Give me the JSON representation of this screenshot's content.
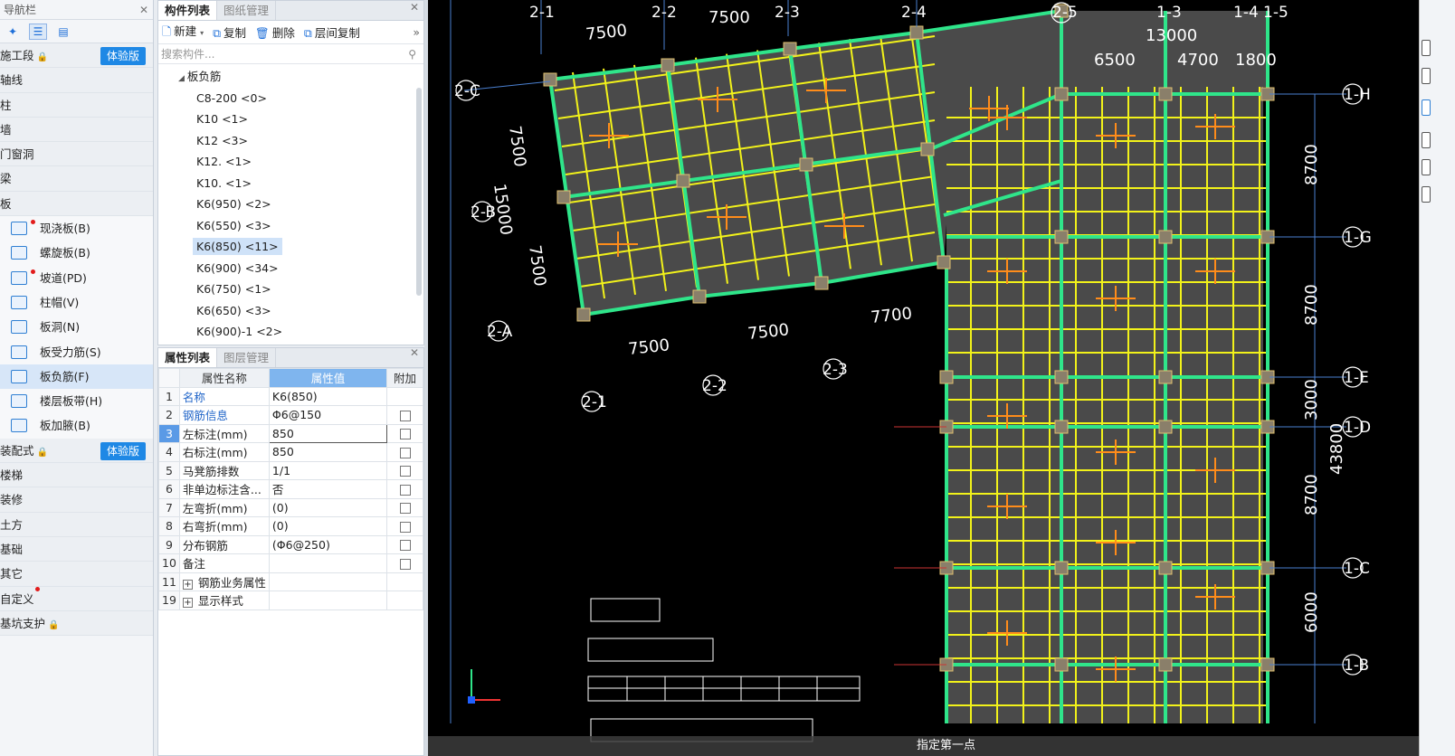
{
  "nav": {
    "title": "导航栏",
    "categories": [
      {
        "label": "施工段",
        "lock": true,
        "trial": "体验版"
      },
      {
        "label": "轴线"
      },
      {
        "label": "柱"
      },
      {
        "label": "墙"
      },
      {
        "label": "门窗洞"
      },
      {
        "label": "梁"
      },
      {
        "label": "板"
      }
    ],
    "slab_items": [
      {
        "label": "现浇板(B)",
        "dot": true
      },
      {
        "label": "螺旋板(B)"
      },
      {
        "label": "坡道(PD)",
        "dot": true
      },
      {
        "label": "柱帽(V)"
      },
      {
        "label": "板洞(N)"
      },
      {
        "label": "板受力筋(S)"
      },
      {
        "label": "板负筋(F)",
        "selected": true
      },
      {
        "label": "楼层板带(H)"
      },
      {
        "label": "板加腋(B)"
      }
    ],
    "categories_after": [
      {
        "label": "装配式",
        "lock": true,
        "trial": "体验版"
      },
      {
        "label": "楼梯"
      },
      {
        "label": "装修"
      },
      {
        "label": "土方"
      },
      {
        "label": "基础"
      },
      {
        "label": "其它"
      },
      {
        "label": "自定义",
        "dot": true
      },
      {
        "label": "基坑支护",
        "lock": true
      }
    ]
  },
  "component_panel": {
    "tabs": [
      "构件列表",
      "图纸管理"
    ],
    "toolbar": {
      "new": "新建",
      "copy": "复制",
      "delete": "删除",
      "floor_copy": "层间复制"
    },
    "search_placeholder": "搜索构件...",
    "tree_root": "板负筋",
    "items": [
      "C8-200 <0>",
      "K10 <1>",
      "K12 <3>",
      "K12. <1>",
      "K10. <1>",
      "K6(950) <2>",
      "K6(550) <3>",
      "K6(850) <11>",
      "K6(900) <34>",
      "K6(750) <1>",
      "K6(650) <3>",
      "K6(900)-1 <2>"
    ],
    "selected_index": 7
  },
  "property_panel": {
    "tabs": [
      "属性列表",
      "图层管理"
    ],
    "headers": {
      "name": "属性名称",
      "value": "属性值",
      "extra": "附加"
    },
    "rows": [
      {
        "no": "1",
        "name": "名称",
        "value": "K6(850)",
        "blue": true,
        "check": false
      },
      {
        "no": "2",
        "name": "钢筋信息",
        "value": "Φ6@150",
        "blue": true,
        "check": true
      },
      {
        "no": "3",
        "name": "左标注(mm)",
        "value": "850",
        "check": true,
        "current": true
      },
      {
        "no": "4",
        "name": "右标注(mm)",
        "value": "850",
        "check": true
      },
      {
        "no": "5",
        "name": "马凳筋排数",
        "value": "1/1",
        "check": true
      },
      {
        "no": "6",
        "name": "非单边标注含...",
        "value": "否",
        "check": true
      },
      {
        "no": "7",
        "name": "左弯折(mm)",
        "value": "(0)",
        "check": true
      },
      {
        "no": "8",
        "name": "右弯折(mm)",
        "value": "(0)",
        "check": true
      },
      {
        "no": "9",
        "name": "分布钢筋",
        "value": "(Φ6@250)",
        "check": true
      },
      {
        "no": "10",
        "name": "备注",
        "value": "",
        "check": true
      },
      {
        "no": "11",
        "name": "钢筋业务属性",
        "value": "",
        "expand": true
      },
      {
        "no": "19",
        "name": "显示样式",
        "value": "",
        "expand": true
      }
    ]
  },
  "cad": {
    "grid_labels_top": [
      "2-1",
      "2-2",
      "7500",
      "2-3",
      "2-4",
      "2-5",
      "1-3",
      "1-4",
      "1-5"
    ],
    "grid_labels_left": [
      "2-C",
      "2-B",
      "2-A"
    ],
    "grid_labels_right": [
      "1-H",
      "1-G",
      "1-E",
      "1-D",
      "1-C",
      "1-B"
    ],
    "grid_labels_bottom": [
      "2-1",
      "2-2",
      "2-3"
    ],
    "dims": {
      "top_a": "7500",
      "top_b": "13000",
      "top_c": "6500",
      "top_d": "4700",
      "top_e": "1800",
      "left_a": "7500",
      "left_b": "15000",
      "left_c": "7500",
      "bot_a": "7500",
      "bot_b": "7500",
      "bot_c": "7700",
      "right_a": "8700",
      "right_b": "8700",
      "right_c": "3000",
      "right_d": "8700",
      "right_e": "6000",
      "right_total": "43800"
    },
    "status_text": "指定第一点",
    "colors": {
      "background": "#000000",
      "beam": "#2fe58a",
      "rebar": "#f2f21a",
      "slab": "#4a4a4a",
      "neg_rebar": "#ff8c1a"
    }
  }
}
